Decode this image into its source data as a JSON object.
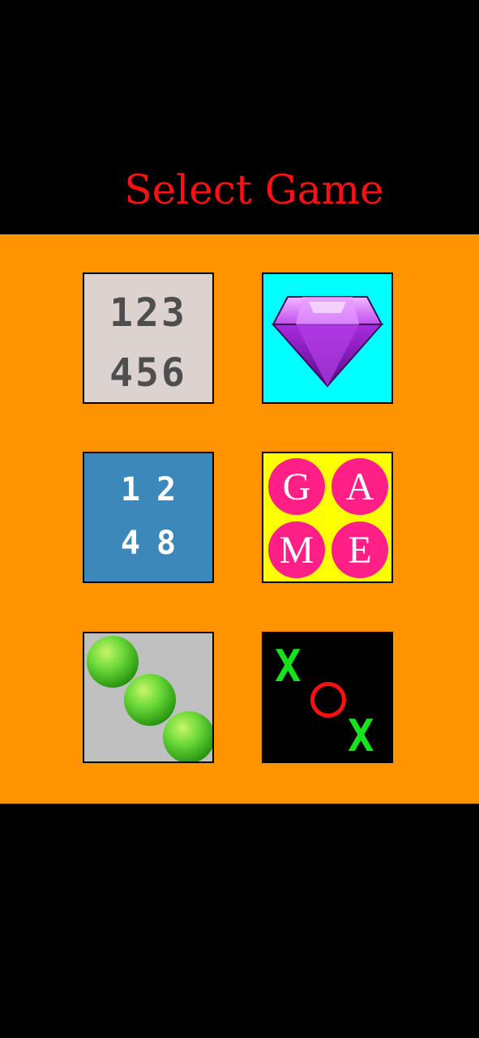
{
  "header": {
    "title": "Select Game"
  },
  "games": [
    {
      "id": "number-puzzle",
      "rows": [
        "123",
        "456"
      ]
    },
    {
      "id": "jewel",
      "icon": "purple-gem-icon"
    },
    {
      "id": "2048",
      "rows": [
        "12",
        "48"
      ]
    },
    {
      "id": "letters",
      "letters": [
        "G",
        "A",
        "M",
        "E"
      ]
    },
    {
      "id": "balls",
      "icon": "green-balls-icon"
    },
    {
      "id": "tic-tac-toe",
      "marks": [
        "X",
        "O",
        "X"
      ]
    }
  ],
  "colors": {
    "background": "#000000",
    "panel": "#ff9400",
    "title": "#ff1010"
  }
}
